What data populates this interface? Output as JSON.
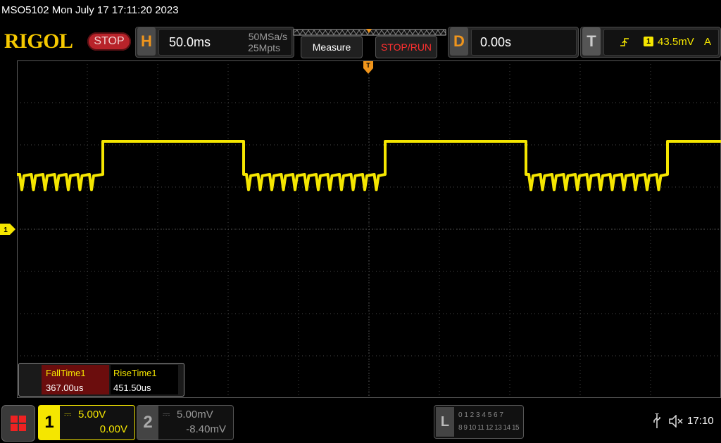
{
  "titlebar": {
    "text": "MSO5102  Mon July 17 17:11:20 2023"
  },
  "header": {
    "logo": "RIGOL",
    "run_state": "STOP",
    "horizontal": {
      "badge": "H",
      "timebase": "50.0ms",
      "sample_rate": "50MSa/s",
      "memory_depth": "25Mpts"
    },
    "buttons": {
      "measure": "Measure",
      "stop_run": "STOP/RUN"
    },
    "delay": {
      "badge": "D",
      "value": "0.00s"
    },
    "trigger": {
      "badge": "T",
      "source": "1",
      "level": "43.5mV",
      "mode": "A"
    }
  },
  "screen": {
    "trigger_marker": "T",
    "ch1_ground_marker": "1",
    "trace_color": "#f5e600",
    "measurements": [
      {
        "label": "FallTime1",
        "value": "367.00us"
      },
      {
        "label": "RiseTime1",
        "value": "451.50us"
      }
    ]
  },
  "footer": {
    "ch1": {
      "number": "1",
      "scale": "5.00V",
      "offset": "0.00V"
    },
    "ch2": {
      "number": "2",
      "scale": "5.00mV",
      "offset": "-8.40mV"
    },
    "logic": {
      "badge": "L",
      "row1": "0 1 2 3  4 5 6 7",
      "row2": "8 9 10 11 12 13 14 15"
    },
    "time": "17:10"
  },
  "colors": {
    "accent_orange": "#f0951c",
    "ch1_yellow": "#f5e600",
    "stop_red": "#b8232a",
    "measure_bg": "#6b0d0d"
  }
}
